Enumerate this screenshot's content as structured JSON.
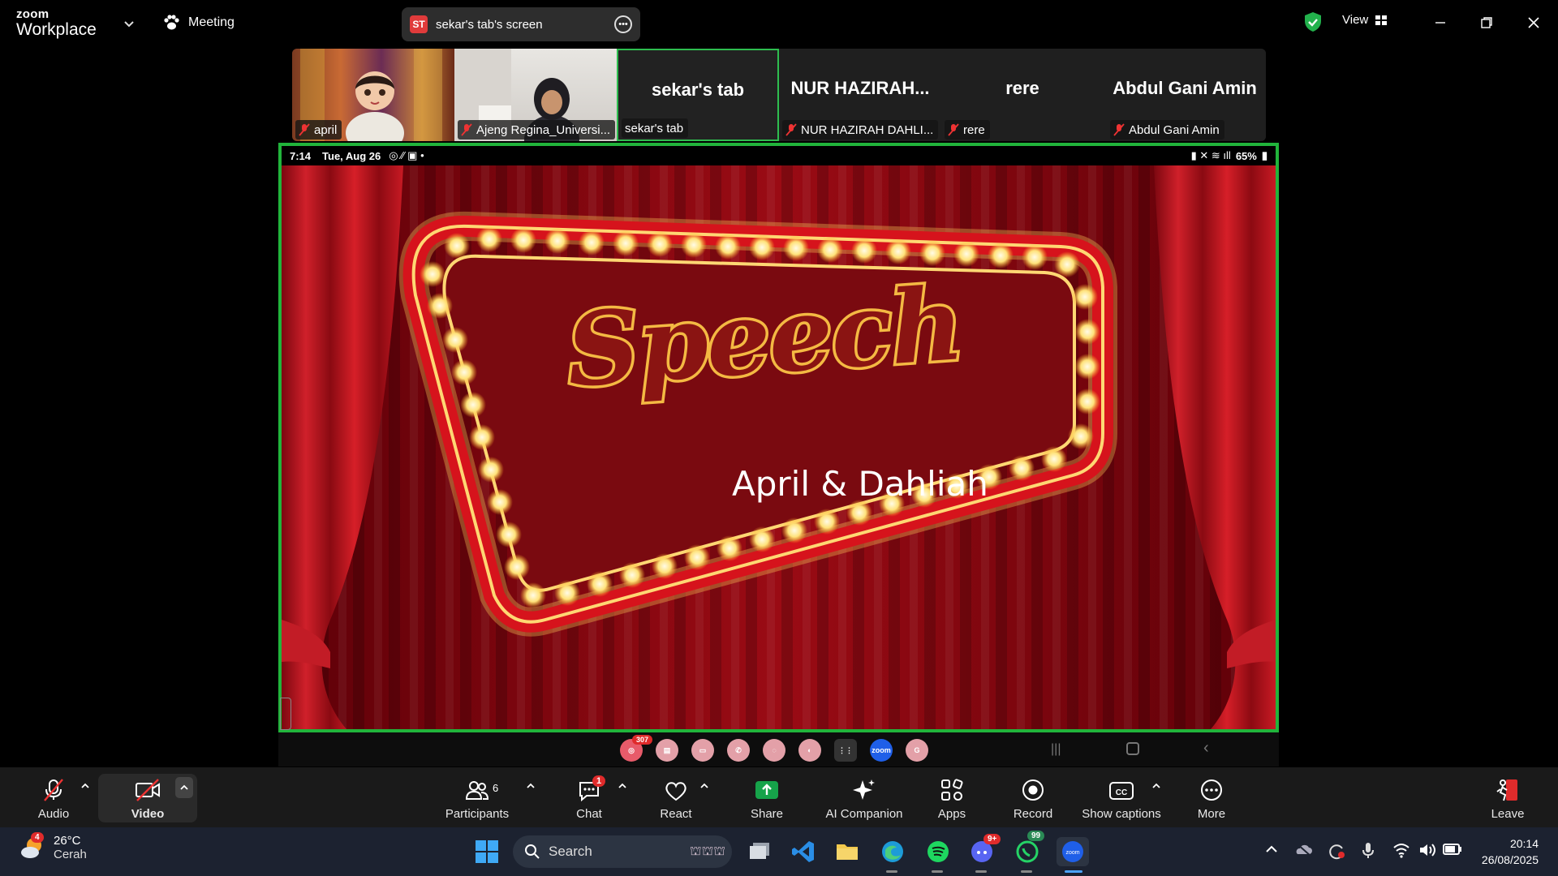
{
  "app": {
    "logo_small": "zoom",
    "logo_big": "Workplace",
    "meeting_label": "Meeting",
    "share_badge": "ST",
    "share_title": "sekar's tab's screen",
    "view_label": "View"
  },
  "participants_strip": [
    {
      "name": "april",
      "muted": true
    },
    {
      "name": "Ajeng Regina_Universi...",
      "muted": true
    },
    {
      "big": "sekar's tab",
      "name": "sekar's tab",
      "muted": false,
      "active": true
    },
    {
      "big": "NUR  HAZIRAH...",
      "name": "NUR HAZIRAH DAHLI...",
      "muted": true
    },
    {
      "big": "rere",
      "name": "rere",
      "muted": true
    },
    {
      "big": "Abdul Gani Amin",
      "name": "Abdul Gani Amin",
      "muted": true
    }
  ],
  "phone": {
    "time": "7:14",
    "date": "Tue, Aug 26",
    "battery": "65%",
    "notif_count": "307"
  },
  "slide": {
    "title": "Speech",
    "subtitle": "April & Dahliah"
  },
  "toolbar": {
    "audio": "Audio",
    "video": "Video",
    "participants": "Participants",
    "participants_count": "6",
    "chat": "Chat",
    "chat_badge": "1",
    "react": "React",
    "share": "Share",
    "ai": "AI Companion",
    "apps": "Apps",
    "record": "Record",
    "captions": "Show captions",
    "more": "More",
    "leave": "Leave"
  },
  "taskbar": {
    "temp": "26°C",
    "condition": "Cerah",
    "weather_badge": "4",
    "search": "Search",
    "discord_badge": "9+",
    "whatsapp_badge": "99",
    "time": "20:14",
    "date": "26/08/2025"
  },
  "colors": {
    "active_border": "#21b43b",
    "share_green": "#16a34a",
    "badge_red": "#e02b2b",
    "curtain_red": "#b3101a"
  }
}
